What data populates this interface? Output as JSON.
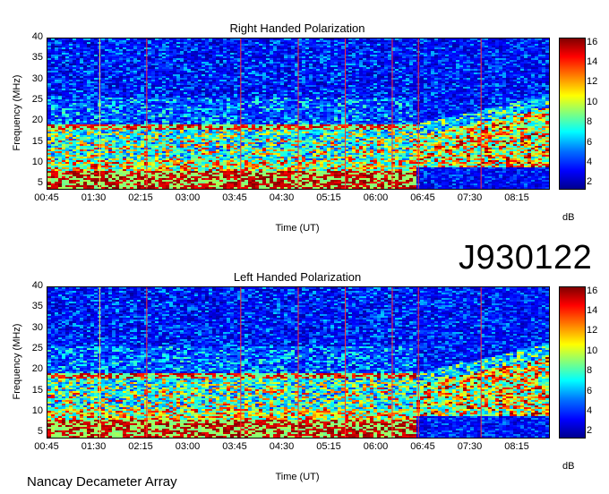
{
  "observation_id": "J930122",
  "source_label": "Nancay Decameter Array",
  "colors": {
    "background_low": "#0a2a9c",
    "vertical_marker": "#ffe14d",
    "vertical_marker_alt": "#ff3030"
  },
  "chart_data": [
    {
      "type": "heatmap",
      "title": "Right Handed Polarization",
      "xlabel": "Time (UT)",
      "ylabel": "Frequency (MHz)",
      "x_ticks": [
        "00:45",
        "01:30",
        "02:15",
        "03:00",
        "03:45",
        "04:30",
        "05:15",
        "06:00",
        "06:45",
        "07:30",
        "08:15"
      ],
      "y_ticks": [
        5,
        10,
        15,
        20,
        25,
        30,
        35,
        40
      ],
      "ylim": [
        4,
        40
      ],
      "time_range": [
        "00:45",
        "08:45"
      ],
      "colorbar": {
        "label": "dB",
        "ticks": [
          2,
          4,
          6,
          8,
          10,
          12,
          14,
          16
        ],
        "range": [
          1.5,
          16.5
        ],
        "colormap": "jet"
      },
      "markers_ut": [
        "01:35",
        "02:20",
        "03:50",
        "04:45",
        "05:30",
        "06:15",
        "06:40",
        "07:40"
      ]
    },
    {
      "type": "heatmap",
      "title": "Left Handed Polarization",
      "xlabel": "Time (UT)",
      "ylabel": "Frequency (MHz)",
      "x_ticks": [
        "00:45",
        "01:30",
        "02:15",
        "03:00",
        "03:45",
        "04:30",
        "05:15",
        "06:00",
        "06:45",
        "07:30",
        "08:15"
      ],
      "y_ticks": [
        5,
        10,
        15,
        20,
        25,
        30,
        35,
        40
      ],
      "ylim": [
        4,
        40
      ],
      "time_range": [
        "00:45",
        "08:45"
      ],
      "colorbar": {
        "label": "dB",
        "ticks": [
          2,
          4,
          6,
          8,
          10,
          12,
          14,
          16
        ],
        "range": [
          1.5,
          16.5
        ],
        "colormap": "jet"
      },
      "markers_ut": [
        "01:35",
        "02:20",
        "03:50",
        "04:45",
        "05:30",
        "06:15",
        "06:40",
        "07:40"
      ]
    }
  ]
}
